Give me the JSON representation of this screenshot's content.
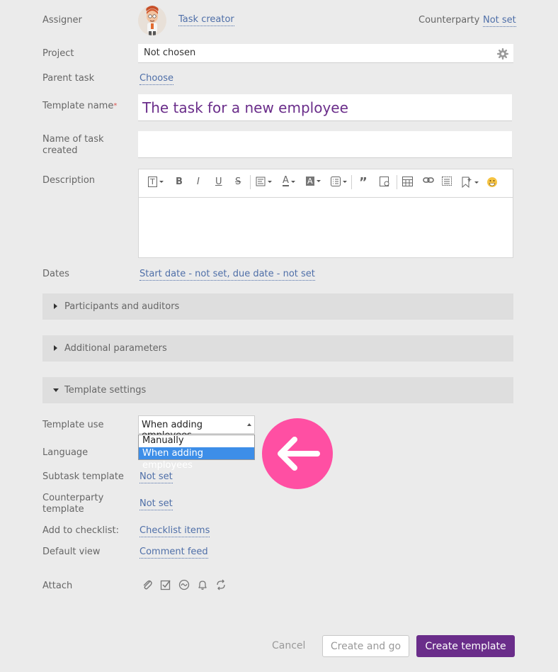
{
  "assigner": {
    "label": "Assigner",
    "value": "Task creator"
  },
  "counterparty": {
    "label": "Counterparty",
    "value": "Not set"
  },
  "project": {
    "label": "Project",
    "value": "Not chosen"
  },
  "parent_task": {
    "label": "Parent task",
    "value": "Choose"
  },
  "template_name": {
    "label": "Template name",
    "required_mark": "*",
    "value": "The task for a new employee"
  },
  "task_name": {
    "label_line1": "Name of task",
    "label_line2": "created",
    "value": ""
  },
  "description": {
    "label": "Description"
  },
  "dates": {
    "label": "Dates",
    "value": "Start date - not set, due date - not set"
  },
  "sections": {
    "participants": "Participants and auditors",
    "additional": "Additional parameters",
    "template_settings": "Template settings"
  },
  "template_use": {
    "label": "Template use",
    "selected": "When adding employees",
    "options": [
      "Manually",
      "When adding employees"
    ]
  },
  "language": {
    "label": "Language"
  },
  "subtask_template": {
    "label": "Subtask template",
    "value": "Not set"
  },
  "counterparty_template": {
    "label_line1": "Counterparty",
    "label_line2": "template",
    "value": "Not set"
  },
  "checklist": {
    "label": "Add to checklist:",
    "value": "Checklist items"
  },
  "default_view": {
    "label": "Default view",
    "value": "Comment feed"
  },
  "attach": {
    "label": "Attach"
  },
  "buttons": {
    "cancel": "Cancel",
    "create_and_go": "Create and go",
    "create_template": "Create template"
  },
  "colors": {
    "accent": "#6a2d8a",
    "link": "#4f6fa8",
    "highlight": "#ff4fa3",
    "selected_option": "#3d8ee8"
  }
}
